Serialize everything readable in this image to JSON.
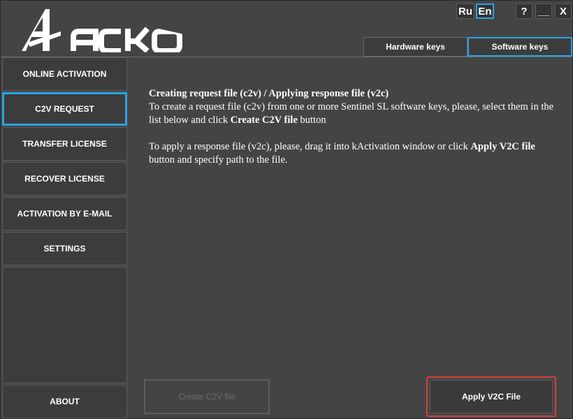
{
  "brand": {
    "logo_text": "АСКОН"
  },
  "window_controls": {
    "lang_ru": "Ru",
    "lang_en": "En",
    "active_lang": "En",
    "help": "?",
    "minimize": "__",
    "close": "X"
  },
  "key_tabs": [
    {
      "label": "Hardware keys",
      "active": false
    },
    {
      "label": "Software keys",
      "active": true
    }
  ],
  "sidebar": {
    "items": [
      {
        "label": "ONLINE ACTIVATION",
        "active": false
      },
      {
        "label": "C2V REQUEST",
        "active": true
      },
      {
        "label": "TRANSFER LICENSE",
        "active": false
      },
      {
        "label": "RECOVER LICENSE",
        "active": false
      },
      {
        "label": "ACTIVATION BY E-MAIL",
        "active": false
      },
      {
        "label": "SETTINGS",
        "active": false
      }
    ],
    "about": "ABOUT"
  },
  "content": {
    "heading": "Creating request file (c2v) / Applying response file (v2c)",
    "p1_text": "To create a request file (c2v) from one or more Sentinel SL software keys, please, select them in the list below and click ",
    "p1_bold": "Create C2V file",
    "p1_tail": " button",
    "p2_text": "To apply a response file (v2c), please, drag it into kActivation window or click ",
    "p2_bold": "Apply V2C file",
    "p2_tail": " button and specify path to the file."
  },
  "actions": {
    "create_c2v": "Create C2V file",
    "create_c2v_enabled": false,
    "apply_v2c": "Apply V2C File"
  },
  "colors": {
    "background": "#444444",
    "panel": "#3c3c3c",
    "accent_blue": "#29a3e6",
    "highlight_red": "#d9413a",
    "text": "#ffffff",
    "disabled_text": "#6e6e6e"
  }
}
